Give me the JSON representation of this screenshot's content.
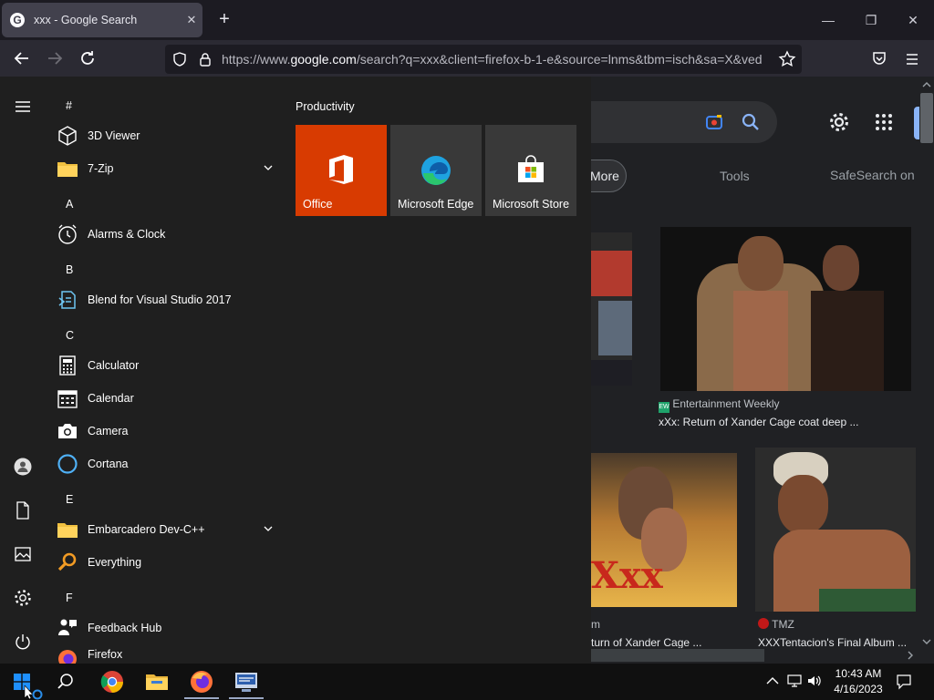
{
  "browser": {
    "tab_title": "xxx - Google Search",
    "favicon_letter": "G",
    "url_prefix": "https://www.",
    "url_domain": "google.com",
    "url_rest": "/search?q=xxx&client=firefox-b-1-e&source=lnms&tbm=isch&sa=X&ved"
  },
  "google": {
    "more_label": "More",
    "tools_label": "Tools",
    "safesearch_label": "SafeSearch on",
    "results": [
      {
        "source": "Entertainment Weekly",
        "source_badge": "EW",
        "title": "xXx: Return of Xander Cage coat deep ..."
      },
      {
        "source": "m",
        "title": "turn of Xander Cage ..."
      },
      {
        "source": "TMZ",
        "title": "XXXTentacion's Final Album ..."
      }
    ]
  },
  "start_menu": {
    "sections": [
      {
        "letter": "#"
      },
      {
        "letter": "A"
      },
      {
        "letter": "B"
      },
      {
        "letter": "C"
      },
      {
        "letter": "E"
      },
      {
        "letter": "F"
      }
    ],
    "apps": [
      {
        "label": "3D Viewer",
        "icon": "cube-icon"
      },
      {
        "label": "7-Zip",
        "icon": "folder-icon",
        "expandable": true
      },
      {
        "label": "Alarms & Clock",
        "icon": "alarm-clock-icon"
      },
      {
        "label": "Blend for Visual Studio 2017",
        "icon": "blend-icon"
      },
      {
        "label": "Calculator",
        "icon": "calculator-icon"
      },
      {
        "label": "Calendar",
        "icon": "calendar-icon"
      },
      {
        "label": "Camera",
        "icon": "camera-icon"
      },
      {
        "label": "Cortana",
        "icon": "cortana-icon"
      },
      {
        "label": "Embarcadero Dev-C++",
        "icon": "folder-icon",
        "expandable": true
      },
      {
        "label": "Everything",
        "icon": "magnifier-icon"
      },
      {
        "label": "Feedback Hub",
        "icon": "feedback-icon"
      },
      {
        "label": "Firefox",
        "icon": "firefox-icon"
      }
    ],
    "group_title": "Productivity",
    "tiles": [
      {
        "label": "Office",
        "color": "#d83b01"
      },
      {
        "label": "Microsoft Edge",
        "color": "#393939"
      },
      {
        "label": "Microsoft Store",
        "color": "#393939"
      }
    ]
  },
  "taskbar": {
    "time": "10:43 AM",
    "date": "4/16/2023"
  }
}
